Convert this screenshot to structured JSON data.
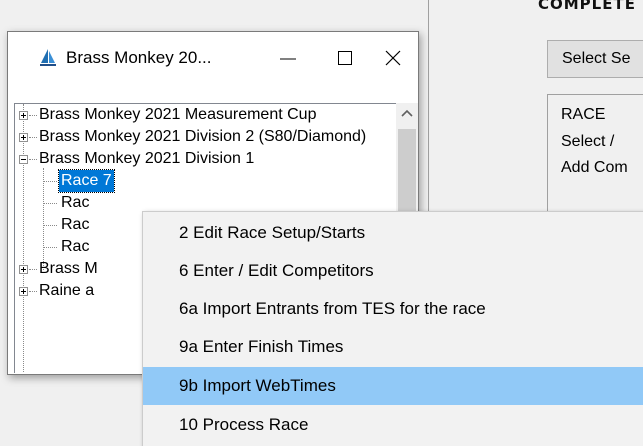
{
  "background_window": {
    "heading": "COMPLETE",
    "select_button_label": "Select Se",
    "race_label": "RACE",
    "select_label": "Select /",
    "add_label": "Add Com"
  },
  "window": {
    "title": "Brass Monkey 20...",
    "controls": {
      "minimize": "minimize-icon",
      "maximize": "maximize-icon",
      "close": "close-icon"
    }
  },
  "tree": {
    "items": [
      {
        "label": "Brass Monkey 2021 Measurement Cup",
        "expander": "plus"
      },
      {
        "label": "Brass Monkey 2021 Division 2 (S80/Diamond)",
        "expander": "plus"
      },
      {
        "label": "Brass Monkey 2021 Division 1",
        "expander": "minus"
      },
      {
        "label": "Race 7",
        "selected": true
      },
      {
        "label": "Rac"
      },
      {
        "label": "Rac"
      },
      {
        "label": "Rac"
      },
      {
        "label": "Brass M",
        "expander": "plus"
      },
      {
        "label": "Raine a",
        "expander": "plus"
      }
    ]
  },
  "context_menu": {
    "items": [
      {
        "label": "2  Edit Race Setup/Starts"
      },
      {
        "label": "6  Enter / Edit Competitors"
      },
      {
        "label": "6a  Import Entrants from TES for the race"
      },
      {
        "label": "9a  Enter Finish Times"
      },
      {
        "label": "9b  Import WebTimes",
        "highlighted": true
      },
      {
        "label": "10  Process Race"
      }
    ]
  },
  "colors": {
    "selection": "#0078d7",
    "menu_highlight": "#91c9f7",
    "menu_background": "#f2f2f2",
    "window_background": "#f0f0f0"
  }
}
